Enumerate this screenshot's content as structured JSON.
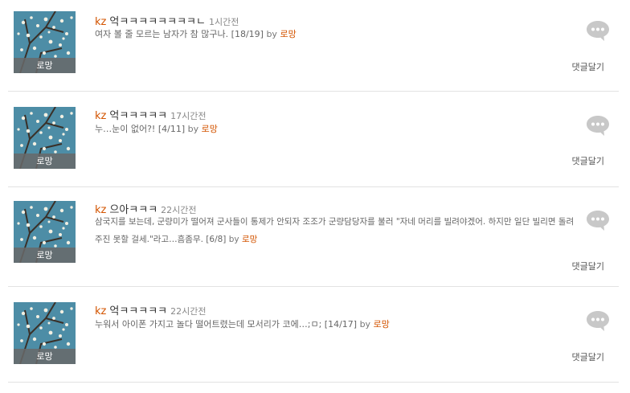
{
  "comments": [
    {
      "nickname": "kz",
      "message": "억ㅋㅋㅋㅋㅋㅋㅋㅋㄴ",
      "time": "1시간전",
      "quote": "여자 볼 줄 모르는 남자가 참 많구나.",
      "ref": "[18/19]",
      "by": "by",
      "author": "로망",
      "thumb_caption": "로망",
      "reply_label": "댓글달기"
    },
    {
      "nickname": "kz",
      "message": "억ㅋㅋㅋㅋㅋ",
      "time": "17시간전",
      "quote": "누…눈이 없어?!",
      "ref": "[4/11]",
      "by": "by",
      "author": "로망",
      "thumb_caption": "로망",
      "reply_label": "댓글달기"
    },
    {
      "nickname": "kz",
      "message": "으아ㅋㅋㅋ",
      "time": "22시간전",
      "quote": "삼국지를 보는데, 군량미가 떨어져 군사들이 통제가 안되자 조조가 군량담당자를 불러 \"자네 머리를 빌려야겠어. 하지만 일단 빌리면 돌려주진 못할 걸세.\"라고…흠좀무.",
      "ref": "[6/8]",
      "by": "by",
      "author": "로망",
      "thumb_caption": "로망",
      "reply_label": "댓글달기"
    },
    {
      "nickname": "kz",
      "message": "억ㅋㅋㅋㅋㅋ",
      "time": "22시간전",
      "quote": "누워서 아이폰 가지고 놀다 떨어트렸는데 모서리가 코에…;ㅁ;",
      "ref": "[14/17]",
      "by": "by",
      "author": "로망",
      "thumb_caption": "로망",
      "reply_label": "댓글달기"
    }
  ],
  "colors": {
    "accent": "#d35400",
    "bubble": "#c8c8c8",
    "divider": "#e2e2e2",
    "thumb_sky": "#4d8da6"
  },
  "icons": {
    "bubble": "speech-bubble-icon"
  }
}
